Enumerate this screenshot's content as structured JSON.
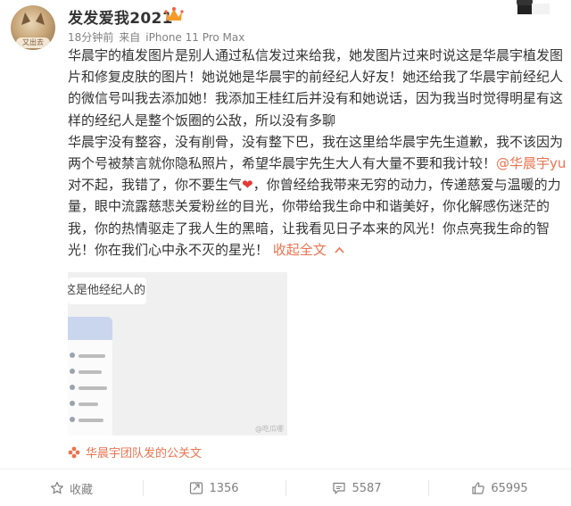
{
  "post": {
    "author": "发发爱我2021",
    "time": "18分钟前",
    "source_prefix": "来自",
    "device": "iPhone 11 Pro Max",
    "avatar_caption": "又出去",
    "text_part1": "华晨宇的植发图片是别人通过私信发过来给我，她发图片过来时说这是华晨宇植发图片和修复皮肤的图片！她说她是华晨宇的前经纪人好友！她还给我了华晨宇前经纪人的微信号叫我去添加她！我添加王桂红后并没有和她说话，因为我当时觉得明星有这样的经纪人是整个饭圈的公敌，所以没有多聊",
    "text_part2": "华晨宇没有整容，没有削骨，没有整下巴，我在这里给华晨宇先生道歉，我不该因为两个号被禁言就你隐私照片，希望华晨宇先生大人有大量不要和我计较！",
    "mention": "@华晨宇yu",
    "text_part3": " 对不起，我错了，你不要生气",
    "heart": "❤",
    "text_part4": "，你曾经给我带来无穷的动力，传递慈爱与温暖的力量，眼中流露慈悲关爱粉丝的目光，你带给我生命中和谐美好，你化解感伤迷茫的我，你的热情驱走了我人生的黑暗，让我看见日子本来的风光！你点亮我生命的智光！你在我们心中永不灭的星光！",
    "collapse_label": "收起全文",
    "media_bubble_text": "这是他经纪人的",
    "media_watermark": "@吃瓜哪"
  },
  "source_link": "华晨宇团队发的公关文",
  "actions": {
    "favorite_label": "收藏",
    "repost_count": "1356",
    "comment_count": "5587",
    "like_count": "65995"
  },
  "colors": {
    "accent": "#eb7350",
    "text": "#333333",
    "muted": "#808080"
  },
  "icons": [
    "star-icon",
    "repost-icon",
    "comment-icon",
    "like-icon",
    "vip-crown-icon",
    "chevron-up-icon"
  ]
}
